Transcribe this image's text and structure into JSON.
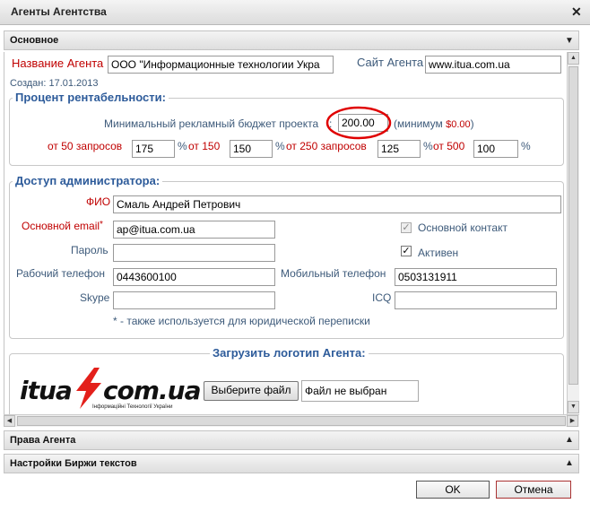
{
  "window": {
    "title": "Агенты Агентства"
  },
  "sections": {
    "main": "Основное",
    "rights": "Права Агента",
    "exchange": "Настройки Биржи текстов"
  },
  "agent": {
    "name_label": "Название Агента",
    "name_value": "ООО \"Информационные технологии Укра",
    "site_label": "Сайт Агента",
    "site_value": "www.itua.com.ua",
    "created": "Создан: 17.01.2013"
  },
  "profit": {
    "legend": "Процент рентабельности:",
    "budget_label": "Минимальный рекламный бюджет проекта",
    "budget_value": "200.00",
    "minimum_prefix": "(минимум",
    "minimum_value": "$0.00",
    "minimum_suffix": ")",
    "tiers": [
      {
        "label": "от 50 запросов",
        "value": "175",
        "pct": "%"
      },
      {
        "label": "от 150",
        "value": "150",
        "pct": "%"
      },
      {
        "label": "от 250 запросов",
        "value": "125",
        "pct": "%"
      },
      {
        "label": "от 500",
        "value": "100",
        "pct": "%"
      }
    ]
  },
  "admin": {
    "legend": "Доступ администратора:",
    "fio_label": "ФИО",
    "fio_value": "Смаль Андрей Петрович",
    "email_label": "Основной email",
    "email_star": "*",
    "email_value": "ap@itua.com.ua",
    "main_contact_label": "Основной контакт",
    "password_label": "Пароль",
    "password_value": "",
    "active_label": "Активен",
    "work_phone_label": "Рабочий телефон",
    "work_phone_value": "0443600100",
    "mobile_label": "Мобильный телефон",
    "mobile_value": "0503131911",
    "skype_label": "Skype",
    "skype_value": "",
    "icq_label": "ICQ",
    "icq_value": "",
    "footnote": "* - также используется для юридической переписки"
  },
  "logo_upload": {
    "legend": "Загрузить логотип Агента:",
    "logo_left": "itua",
    "logo_right": "com.ua",
    "logo_sub": "Інформаційні Технології України",
    "choose_button": "Выберите файл",
    "no_file": "Файл не выбран"
  },
  "buttons": {
    "ok": "OK",
    "cancel": "Отмена"
  },
  "colors": {
    "legend": "#2d5b9a",
    "required": "#c00000",
    "annotation": "#e00000",
    "logo_accent": "#e3201b"
  }
}
